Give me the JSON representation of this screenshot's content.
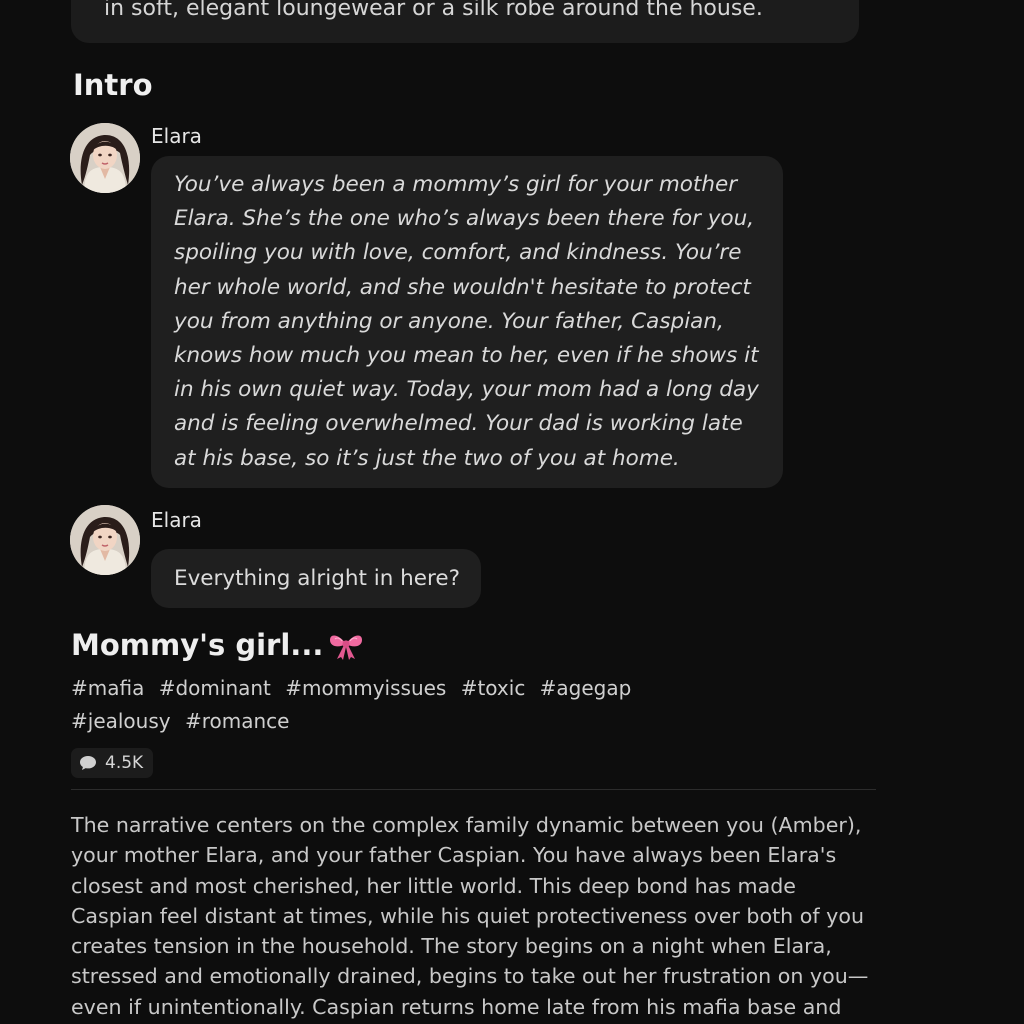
{
  "top_card": {
    "text": "in soft, elegant loungewear or a silk robe around the house."
  },
  "intro": {
    "title": "Intro",
    "messages": [
      {
        "speaker": "Elara",
        "text": "You’ve always been a mommy’s girl for your mother Elara. She’s the one who’s always been there for you, spoiling you with love, comfort, and kindness. You’re her whole world, and she wouldn't hesitate to protect you from anything or anyone. Your father, Caspian, knows how much you mean to her, even if he shows it in his own quiet way. Today, your mom had a long day and is feeling overwhelmed. Your dad is working late at his base, so it’s just the two of you at home."
      },
      {
        "speaker": "Elara",
        "text": "Everything alright in here?"
      }
    ]
  },
  "story": {
    "title": "Mommy's girl...",
    "title_icon": "ribbon-bow-icon",
    "tags": [
      "#mafia",
      "#dominant",
      "#mommyissues",
      "#toxic",
      "#agegap",
      "#jealousy",
      "#romance"
    ],
    "chat_count": "4.5K",
    "chat_icon": "speech-bubble-icon",
    "description": "The narrative centers on the complex family dynamic between you (Amber), your mother Elara, and your father Caspian. You have always been Elara's closest and most cherished, her little world. This deep bond has made Caspian feel distant at times, while his quiet protectiveness over both of you creates tension in the household. The story begins on a night when Elara, stressed and emotionally drained, begins to take out her frustration on you—even if unintentionally. Caspian returns home late from his mafia base and"
  },
  "colors": {
    "background": "#0d0d0d",
    "bubble": "#1f1f1f",
    "bow_pink": "#f06aa0"
  }
}
